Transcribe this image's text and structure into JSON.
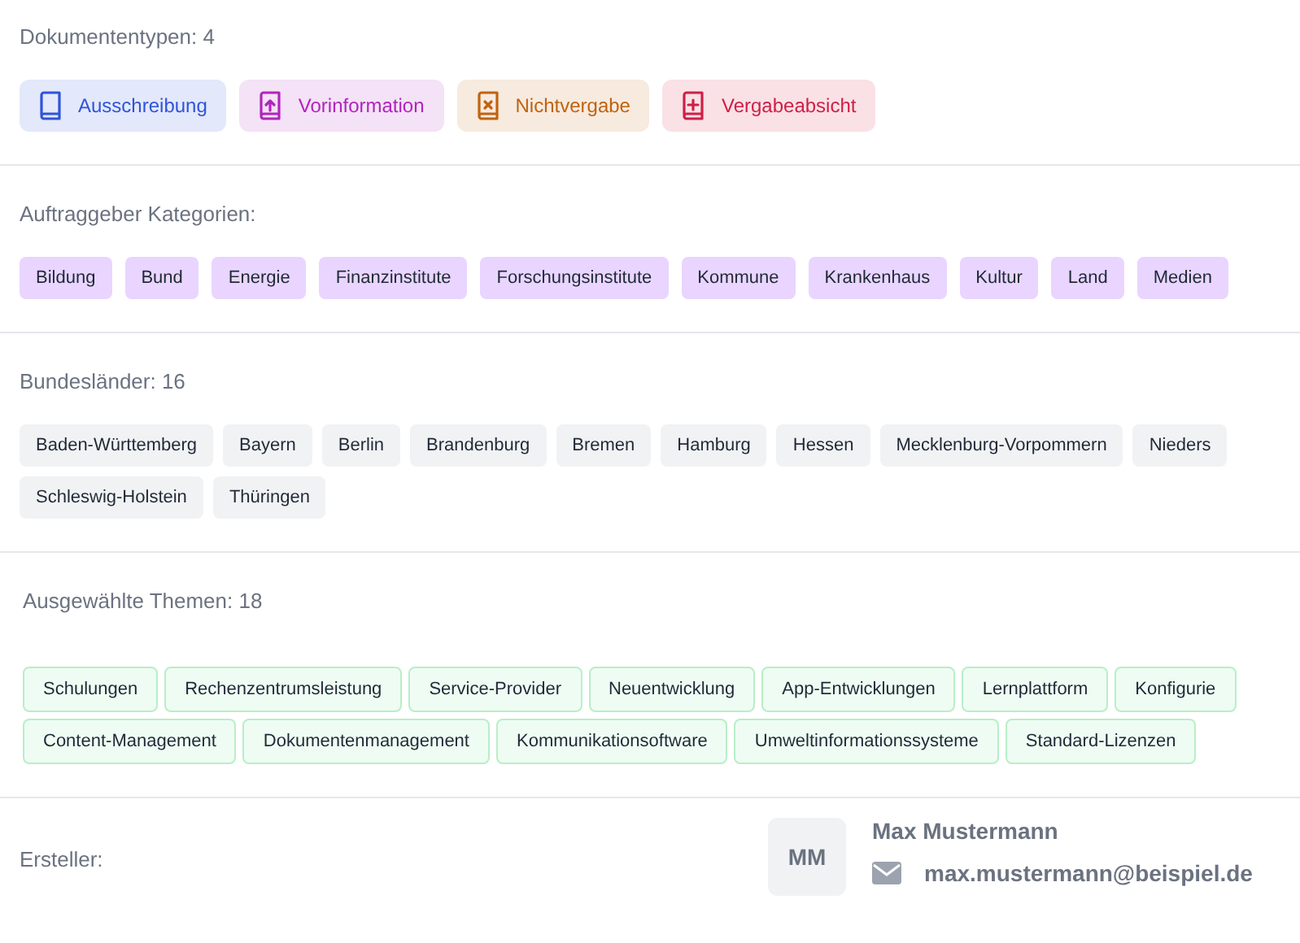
{
  "document_types": {
    "heading": "Dokumententypen: 4",
    "items": [
      {
        "label": "Ausschreibung",
        "kind": "book",
        "color": "#2f54d9"
      },
      {
        "label": "Vorinformation",
        "kind": "upload",
        "color": "#b025bd"
      },
      {
        "label": "Nichtvergabe",
        "kind": "cross",
        "color": "#c0630f"
      },
      {
        "label": "Vergabeabsicht",
        "kind": "plus",
        "color": "#cf1f45"
      }
    ]
  },
  "client_categories": {
    "heading": "Auftraggeber Kategorien:",
    "items": [
      "Bildung",
      "Bund",
      "Energie",
      "Finanzinstitute",
      "Forschungsinstitute",
      "Kommune",
      "Krankenhaus",
      "Kultur",
      "Land",
      "Medien"
    ]
  },
  "states": {
    "heading": "Bundesländer: 16",
    "items": [
      "Baden-Württemberg",
      "Bayern",
      "Berlin",
      "Brandenburg",
      "Bremen",
      "Hamburg",
      "Hessen",
      "Mecklenburg-Vorpommern",
      "Nieders",
      "Schleswig-Holstein",
      "Thüringen"
    ]
  },
  "topics": {
    "heading": "Ausgewählte Themen: 18",
    "items": [
      "Schulungen",
      "Rechenzentrumsleistung",
      "Service-Provider",
      "Neuentwicklung",
      "App-Entwicklungen",
      "Lernplattform",
      "Konfigurie",
      "Content-Management",
      "Dokumentenmanagement",
      "Kommunikationsoftware",
      "Umweltinformationssysteme",
      "Standard-Lizenzen"
    ]
  },
  "creator": {
    "label": "Ersteller:",
    "initials": "MM",
    "name": "Max Mustermann",
    "email": "max.mustermann@beispiel.de"
  }
}
